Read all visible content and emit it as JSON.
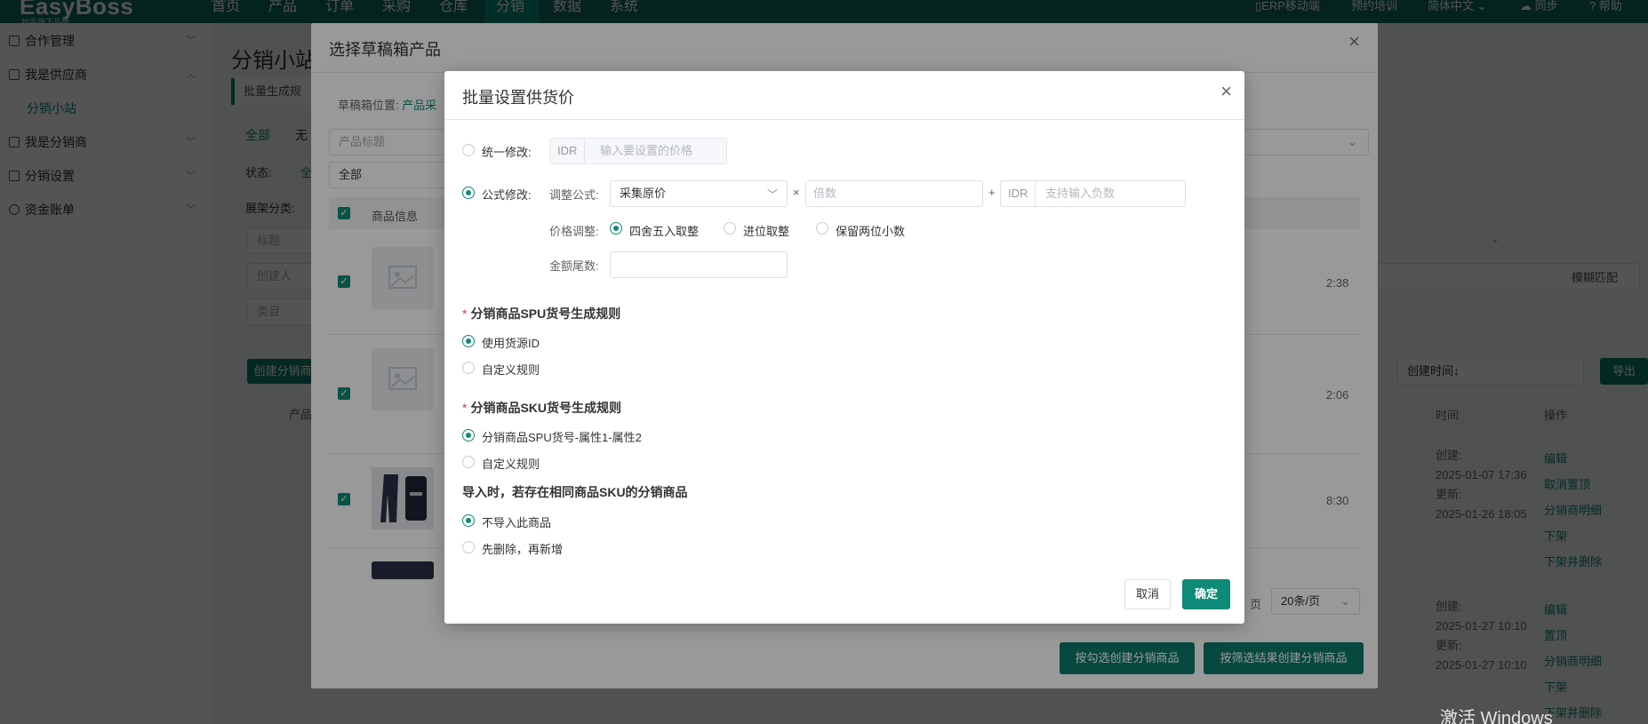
{
  "app": {
    "logo": "EasyBoss",
    "logo_sub": "妙手旗下品牌",
    "nav": [
      "首页",
      "产品",
      "订单",
      "采购",
      "仓库",
      "分销",
      "数据",
      "系统"
    ],
    "nav_active": "分销",
    "nav_right": [
      "ERP移动端",
      "预约培训",
      "简体中文",
      "同步",
      "帮助"
    ]
  },
  "sidebar": {
    "items": [
      {
        "label": "合作管理"
      },
      {
        "label": "我是供应商"
      },
      {
        "label": "我是分销商"
      },
      {
        "label": "分销设置"
      },
      {
        "label": "资金账单"
      }
    ],
    "sub_item": "分销小站"
  },
  "main": {
    "title": "分销小站",
    "banner": "批量生成规",
    "tabs": [
      "全部",
      "无"
    ],
    "status_label": "状态:",
    "status_value": "全",
    "shelf_label": "展架分类:",
    "filters": [
      "标题",
      "创建人",
      "类目"
    ],
    "create_btn": "创建分销商",
    "table_col_product": "产品",
    "col_time": "时间",
    "col_action": "操作",
    "sort_select": "创建时间↓",
    "export_btn": "导出",
    "fuzzy": "模糊匹配",
    "dash": "-",
    "rows": [
      {
        "created_label": "创建:",
        "created": "2025-01-07 17:36",
        "updated_label": "更新:",
        "updated": "2025-01-26 18:05",
        "actions": [
          "编辑",
          "取消置顶",
          "分销商明细",
          "下架",
          "下架并删除"
        ]
      },
      {
        "created_label": "创建:",
        "created": "2025-01-27 10:10",
        "updated_label": "更新:",
        "updated": "2025-01-27 10:10",
        "actions": [
          "编辑",
          "置顶",
          "分销商明细",
          "下架",
          "下架并删除"
        ]
      }
    ]
  },
  "draft_dialog": {
    "title": "选择草稿箱产品",
    "location_label": "草稿箱位置:",
    "location_value": "产品采",
    "search_placeholder": "产品标题",
    "select_value": "全部",
    "col_product_info": "商品信息",
    "times": [
      "2:38",
      "2:06",
      "8:30"
    ],
    "page_text": "页",
    "page_size": "20条/页",
    "btn_create_checked": "按勾选创建分销商品",
    "btn_create_filtered": "按筛选结果创建分销商品"
  },
  "modal": {
    "title": "批量设置供货价",
    "unified": {
      "label": "统一修改:",
      "currency": "IDR",
      "placeholder": "输入要设置的价格"
    },
    "formula": {
      "label": "公式修改:",
      "adjust_label": "调整公式:",
      "base_value": "采集原价",
      "times_sign": "×",
      "multiplier_placeholder": "倍数",
      "plus_sign": "+",
      "currency": "IDR",
      "offset_placeholder": "支持输入负数",
      "price_adjust_label": "价格调整:",
      "rounding_options": [
        "四舍五入取整",
        "进位取整",
        "保留两位小数"
      ],
      "tail_label": "金额尾数:"
    },
    "spu_rule": {
      "title": "分销商品SPU货号生成规则",
      "options": [
        "使用货源ID",
        "自定义规则"
      ]
    },
    "sku_rule": {
      "title": "分销商品SKU货号生成规则",
      "options": [
        "分销商品SPU货号-属性1-属性2",
        "自定义规则"
      ]
    },
    "import_rule": {
      "title": "导入时，若存在相同商品SKU的分销商品",
      "options": [
        "不导入此商品",
        "先删除，再新增"
      ]
    },
    "cancel": "取消",
    "confirm": "确定"
  },
  "watermark": "激活 Windows",
  "colors": {
    "brand": "#0d8a78",
    "nav_bg": "#0d6b5e",
    "required": "#e4393c"
  }
}
